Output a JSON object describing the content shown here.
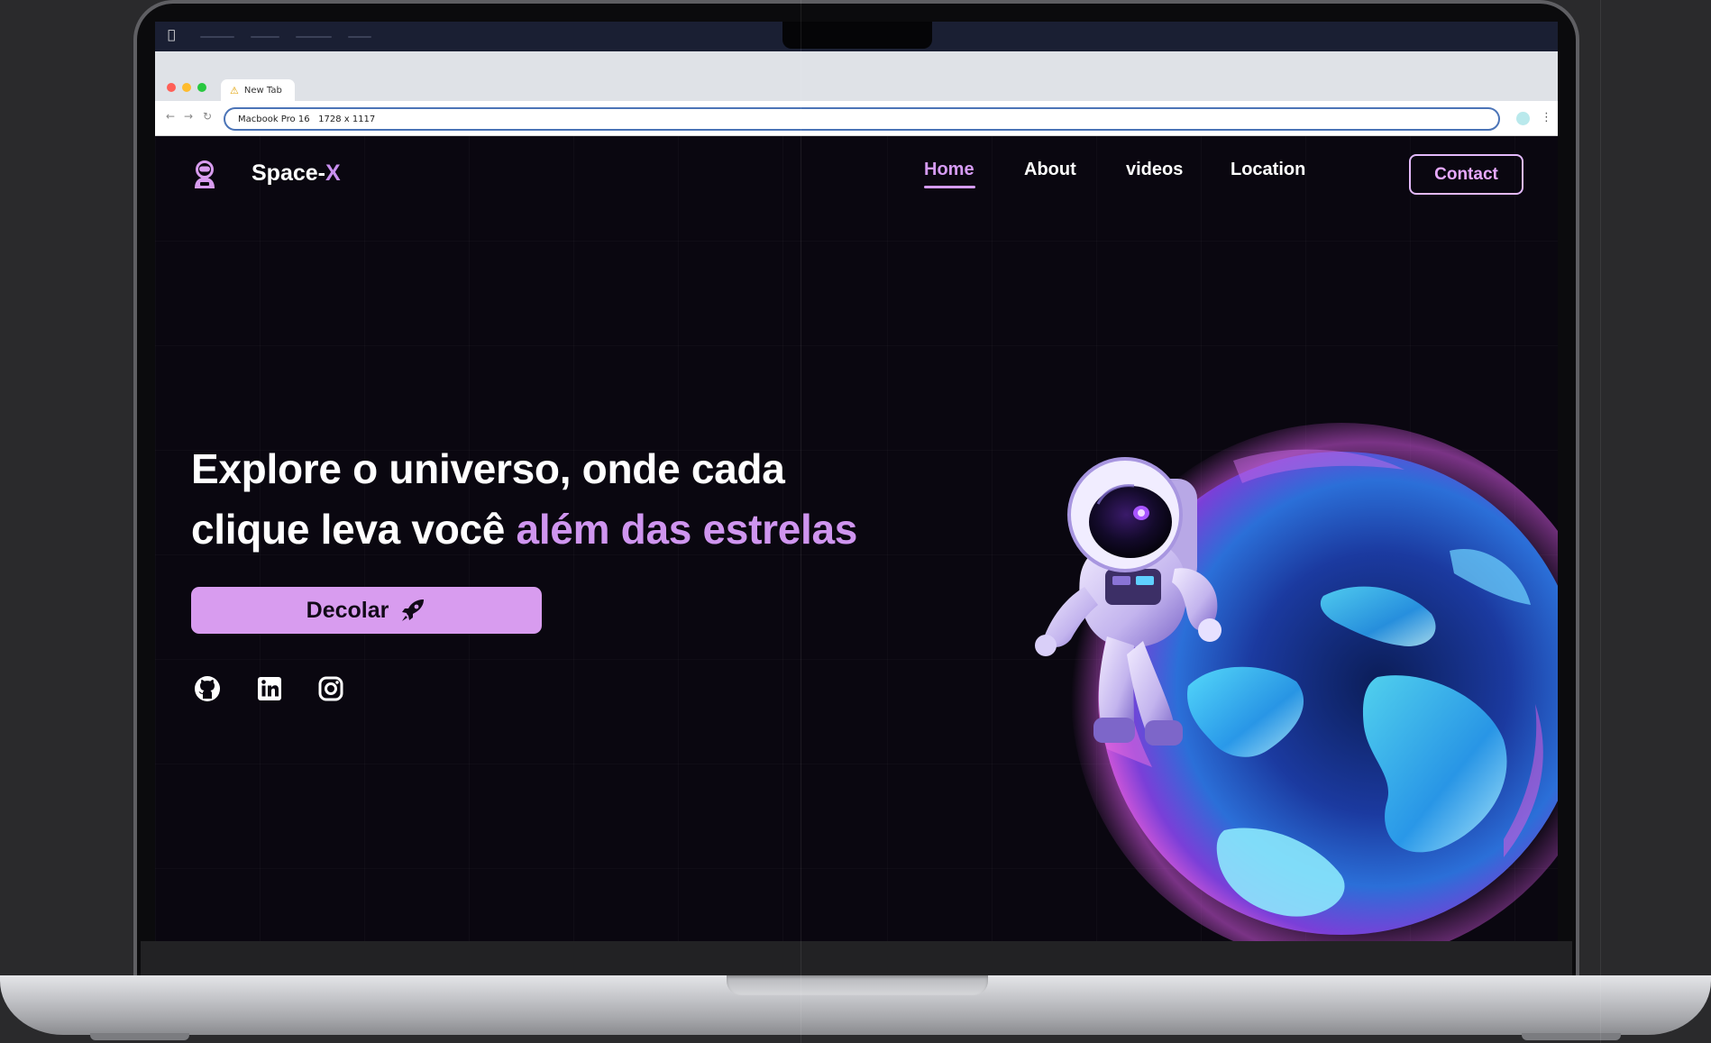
{
  "device": {
    "menubar_icon": "apple-logo-icon"
  },
  "browser": {
    "tab_title": "New Tab",
    "address": "Macbook Pro 16   1728 x 1117"
  },
  "site": {
    "brand_prefix": "Space-",
    "brand_suffix": "X",
    "nav": [
      "Home",
      "About",
      "videos",
      "Location"
    ],
    "active_nav": "Home",
    "contact_label": "Contact",
    "hero_line1": "Explore o universo, onde cada",
    "hero_line2_plain": "clique leva você ",
    "hero_line2_accent": "além das estrelas",
    "cta_label": "Decolar",
    "socials": [
      "github-icon",
      "linkedin-icon",
      "instagram-icon"
    ],
    "colors": {
      "accent": "#d89cef",
      "nav_active": "#d59bf3",
      "background": "#0a0710"
    }
  }
}
